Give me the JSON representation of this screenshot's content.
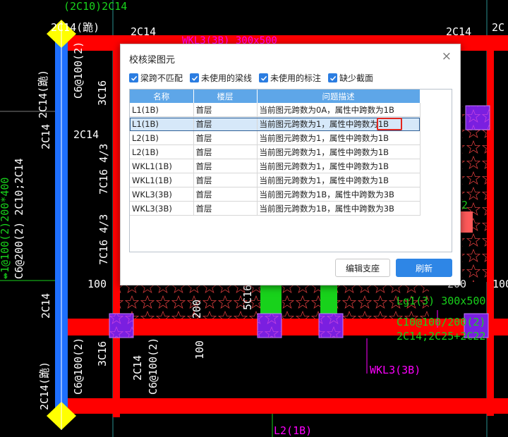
{
  "cad": {
    "labels": {
      "top_left": "(2C10)2C14",
      "top_left2": "2C14(跪)",
      "top_mid": "2C14",
      "top_wkl": "WKL3(3B) 300x500",
      "top_right": "2C14",
      "top_right2": "2C",
      "left_v1": "2C14(跪)",
      "left_v2": "2C14",
      "left_v3": "2C14",
      "left_v4": "2C14(跪)",
      "left_big1": "↮1@100(2)200*400",
      "left_big2": "C6@200(2) 2C10;2C14",
      "col_c6": "C6@100(2)",
      "col_3c16": "3C16",
      "col_2c14": "2C14",
      "col_7c16a": "7C16 4/3",
      "col_7c16b": "7C16 4/3",
      "n100a": "100",
      "n100b": "100",
      "n200": "200",
      "col_5c16": "5C16",
      "bot_c6": "C6@100(2)",
      "bot_3c16": "3C16",
      "bot_2c14": "2C14",
      "bot_c6b": "C6@100(2)",
      "r_lg1": "Lg1(3) 300x500",
      "r_c10": "C10@100/200(2)",
      "r_2c14": "2C14;2C25+2C22",
      "r_wkl": "WKL3(3B)",
      "r_n200": "200",
      "r_n100": "100",
      "r_2": "2",
      "bot_l2": "L2(1B)"
    }
  },
  "dialog": {
    "title": "校核梁图元",
    "filters": [
      {
        "label": "梁跨不匹配",
        "checked": true
      },
      {
        "label": "未使用的梁线",
        "checked": true
      },
      {
        "label": "未使用的标注",
        "checked": true
      },
      {
        "label": "缺少截面",
        "checked": true
      }
    ],
    "columns": [
      "名称",
      "楼层",
      "问题描述"
    ],
    "rows": [
      {
        "name": "L1(1B)",
        "floor": "首层",
        "desc": "当前图元跨数为0A，属性中跨数为1B"
      },
      {
        "name": "L1(1B)",
        "floor": "首层",
        "desc": "当前图元跨数为1，属性中跨数为1B"
      },
      {
        "name": "L2(1B)",
        "floor": "首层",
        "desc": "当前图元跨数为1，属性中跨数为1B"
      },
      {
        "name": "L2(1B)",
        "floor": "首层",
        "desc": "当前图元跨数为1，属性中跨数为1B"
      },
      {
        "name": "WKL1(1B)",
        "floor": "首层",
        "desc": "当前图元跨数为1，属性中跨数为1B"
      },
      {
        "name": "WKL1(1B)",
        "floor": "首层",
        "desc": "当前图元跨数为1，属性中跨数为1B"
      },
      {
        "name": "WKL3(3B)",
        "floor": "首层",
        "desc": "当前图元跨数为1B，属性中跨数为3B"
      },
      {
        "name": "WKL3(3B)",
        "floor": "首层",
        "desc": "当前图元跨数为1B，属性中跨数为3B"
      }
    ],
    "selected_row": 1,
    "buttons": {
      "edit": "编辑支座",
      "refresh": "刷新"
    },
    "close_glyph": "×"
  },
  "colors": {
    "beam": "#ff0000",
    "column": "#7a1fe0",
    "support": "#18d21b",
    "dim_text": "#ffffff",
    "annot": "#ff00ff",
    "selected_axis": "#1e6fff",
    "accent_btn": "#2e86e6"
  }
}
